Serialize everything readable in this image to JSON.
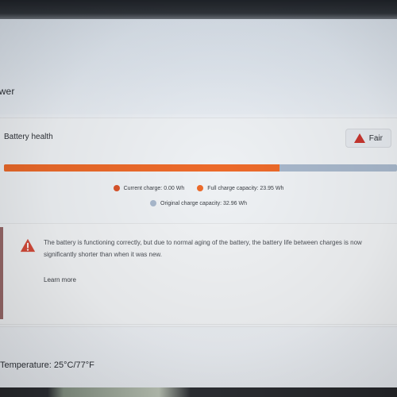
{
  "page": {
    "title_partial": "ower"
  },
  "battery_health": {
    "section_label": "Battery health",
    "status_badge": {
      "label": "Fair",
      "icon": "warning-triangle-icon",
      "color": "#c8352f"
    },
    "capacity_bar": {
      "fill_fraction": 0.7,
      "fill_color": "#ec6a2a",
      "track_color": "#a8b8cc"
    },
    "legend": [
      {
        "text": "Current charge: 0.00 Wh",
        "color": "#d9542b"
      },
      {
        "text": "Full charge capacity: 23.95 Wh",
        "color": "#ec6a2a"
      },
      {
        "text": "Original charge capacity: 32.96 Wh",
        "color": "#a8b8cc"
      }
    ]
  },
  "warning": {
    "icon": "warning-triangle-icon",
    "text": "The battery is functioning correctly, but due to normal aging of the battery, the battery life between charges is now significantly shorter than when it was new.",
    "link_label": "Learn more"
  },
  "temperature": {
    "text": "Temperature: 25°C/77°F"
  }
}
